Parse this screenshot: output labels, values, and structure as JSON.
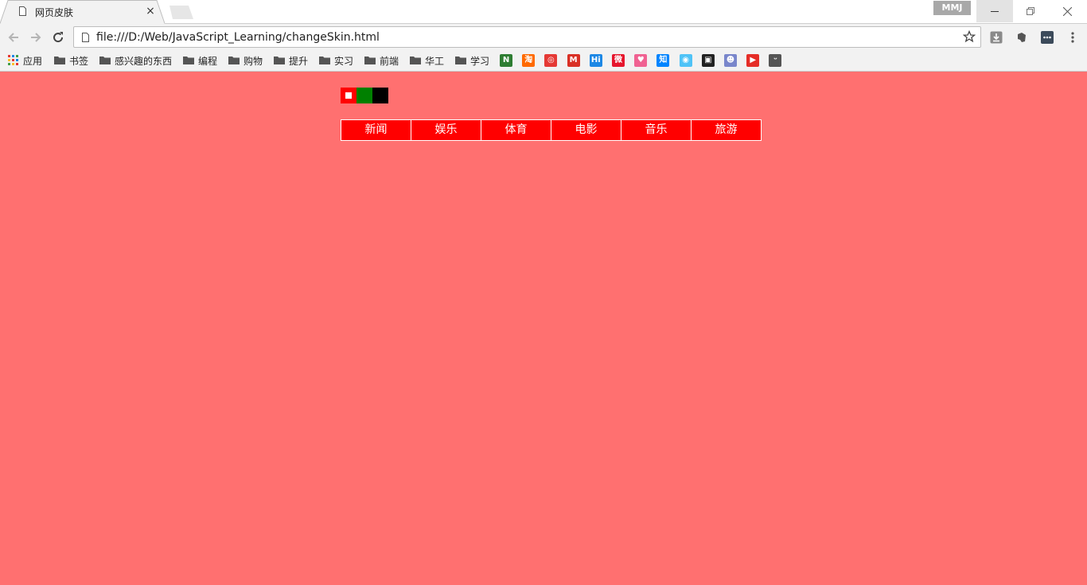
{
  "browser": {
    "tab_title": "网页皮肤",
    "profile_label": "MMJ",
    "url": "file:///D:/Web/JavaScript_Learning/changeSkin.html"
  },
  "bookmarks": {
    "apps_label": "应用",
    "folders": [
      "书签",
      "感兴趣的东西",
      "编程",
      "购物",
      "提升",
      "实习",
      "前端",
      "华工",
      "学习"
    ],
    "icons": [
      {
        "name": "evernote-like-icon",
        "glyph": "N",
        "color": "#2e7d32"
      },
      {
        "name": "taobao-icon",
        "glyph": "淘",
        "color": "#ff6a00"
      },
      {
        "name": "chrome-store-icon",
        "glyph": "◎",
        "color": "#e53935"
      },
      {
        "name": "gmail-icon",
        "glyph": "M",
        "color": "#d93025"
      },
      {
        "name": "hi-icon",
        "glyph": "Hi",
        "color": "#1e88e5"
      },
      {
        "name": "weibo-icon",
        "glyph": "微",
        "color": "#e6162d"
      },
      {
        "name": "heart-icon",
        "glyph": "♥",
        "color": "#f06292"
      },
      {
        "name": "zhihu-icon",
        "glyph": "知",
        "color": "#0084ff"
      },
      {
        "name": "globe-icon",
        "glyph": "◉",
        "color": "#4fc3f7"
      },
      {
        "name": "tv-icon",
        "glyph": "▣",
        "color": "#222222"
      },
      {
        "name": "cat-icon",
        "glyph": "☻",
        "color": "#7986cb"
      },
      {
        "name": "youtube-icon",
        "glyph": "▶",
        "color": "#e52d27"
      },
      {
        "name": "face-icon",
        "glyph": "ᵕ",
        "color": "#555555"
      }
    ]
  },
  "skins": [
    {
      "name": "red",
      "color": "#ff0000",
      "active": true
    },
    {
      "name": "green",
      "color": "#008000",
      "active": false
    },
    {
      "name": "black",
      "color": "#000000",
      "active": false
    }
  ],
  "nav": {
    "items": [
      "新闻",
      "娱乐",
      "体育",
      "电影",
      "音乐",
      "旅游"
    ],
    "color": "#ff0000"
  },
  "page": {
    "background": "#ff7070"
  }
}
